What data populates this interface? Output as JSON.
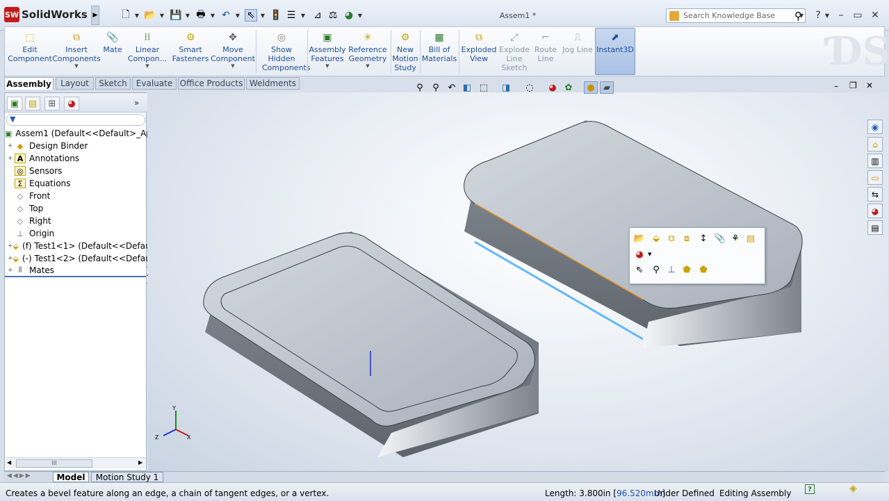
{
  "app": {
    "name": "SolidWorks",
    "logo_text": "SW",
    "document_title": "Assem1 *"
  },
  "search": {
    "placeholder": "Search Knowledge Base"
  },
  "ribbon": {
    "commands": [
      {
        "label": "Edit Component",
        "icon": "edit-component-icon"
      },
      {
        "label": "Insert Components",
        "icon": "insert-components-icon"
      },
      {
        "label": "Mate",
        "icon": "mate-paperclip-icon"
      },
      {
        "label": "Linear Compon...",
        "icon": "linear-pattern-icon"
      },
      {
        "label": "Smart Fasteners",
        "icon": "smart-fasteners-icon"
      },
      {
        "label": "Move Component",
        "icon": "move-component-icon"
      },
      {
        "label": "Show Hidden Components",
        "icon": "show-hidden-icon"
      },
      {
        "label": "Assembly Features",
        "icon": "assembly-features-icon"
      },
      {
        "label": "Reference Geometry",
        "icon": "reference-geometry-icon"
      },
      {
        "label": "New Motion Study",
        "icon": "motion-study-icon"
      },
      {
        "label": "Bill of Materials",
        "icon": "bom-icon"
      },
      {
        "label": "Exploded View",
        "icon": "exploded-view-icon"
      },
      {
        "label": "Explode Line Sketch",
        "icon": "explode-line-icon"
      },
      {
        "label": "Route Line",
        "icon": "route-line-icon"
      },
      {
        "label": "Jog Line",
        "icon": "jog-line-icon"
      },
      {
        "label": "Instant3D",
        "icon": "instant3d-icon"
      }
    ]
  },
  "command_tabs": [
    "Assembly",
    "Layout",
    "Sketch",
    "Evaluate",
    "Office Products",
    "Weldments"
  ],
  "tree": {
    "filter_symbol": "▼",
    "items": [
      {
        "label": "Assem1  (Default<<Default>_App",
        "expander": "",
        "icon": "assembly-icon"
      },
      {
        "label": "Design Binder",
        "expander": "+",
        "icon": "design-binder-icon"
      },
      {
        "label": "Annotations",
        "expander": "+",
        "icon": "annotations-icon"
      },
      {
        "label": "Sensors",
        "expander": "",
        "icon": "sensors-icon"
      },
      {
        "label": "Equations",
        "expander": "",
        "icon": "equations-icon"
      },
      {
        "label": "Front",
        "expander": "",
        "icon": "plane-icon"
      },
      {
        "label": "Top",
        "expander": "",
        "icon": "plane-icon"
      },
      {
        "label": "Right",
        "expander": "",
        "icon": "plane-icon"
      },
      {
        "label": "Origin",
        "expander": "",
        "icon": "origin-icon"
      },
      {
        "label": "(f) Test1<1> (Default<<Defaul",
        "expander": "+",
        "icon": "part-icon"
      },
      {
        "label": "(-) Test1<2> (Default<<Defaul",
        "expander": "+",
        "icon": "part-icon"
      },
      {
        "label": "Mates",
        "expander": "+",
        "icon": "mates-icon"
      }
    ],
    "scroll_thumb": "III"
  },
  "triad": {
    "x": "X",
    "y": "Y",
    "z": "Z"
  },
  "bottom_tabs": [
    "Model",
    "Motion Study 1"
  ],
  "status": {
    "hint": "Creates a bevel feature along an edge, a chain of tangent edges, or a vertex.",
    "length_prefix": "Length: 3.800in [",
    "length_metric": "96.520mm",
    "length_suffix": "]",
    "state": "Under Defined",
    "mode": "Editing Assembly",
    "help": "?"
  }
}
